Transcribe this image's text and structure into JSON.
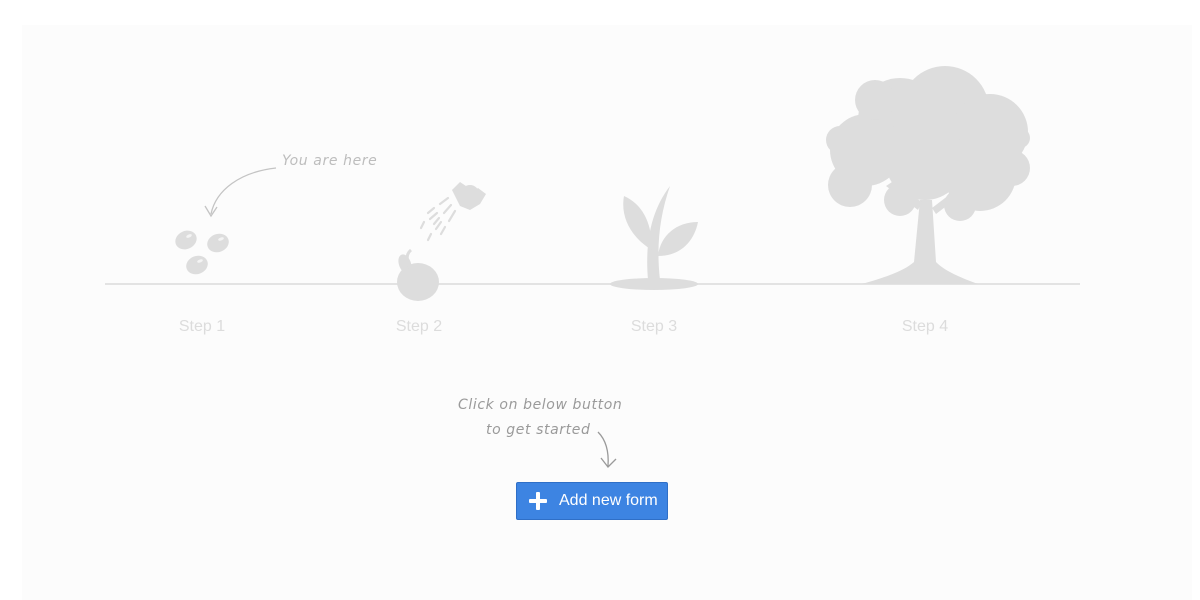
{
  "steps": [
    {
      "label": "Step 1",
      "icon": "seeds-icon"
    },
    {
      "label": "Step 2",
      "icon": "watering-can-icon"
    },
    {
      "label": "Step 3",
      "icon": "sprout-icon"
    },
    {
      "label": "Step 4",
      "icon": "tree-icon"
    }
  ],
  "you_are_here": "You are here",
  "hint": {
    "line1": "Click on below button",
    "line2": "to get started"
  },
  "add_button": {
    "label": "Add new form",
    "icon": "plus-icon",
    "color": "#3d84e2"
  },
  "colors": {
    "illustration": "#dddddd",
    "timeline": "#e3e3e3",
    "background": "#fcfcfc"
  }
}
